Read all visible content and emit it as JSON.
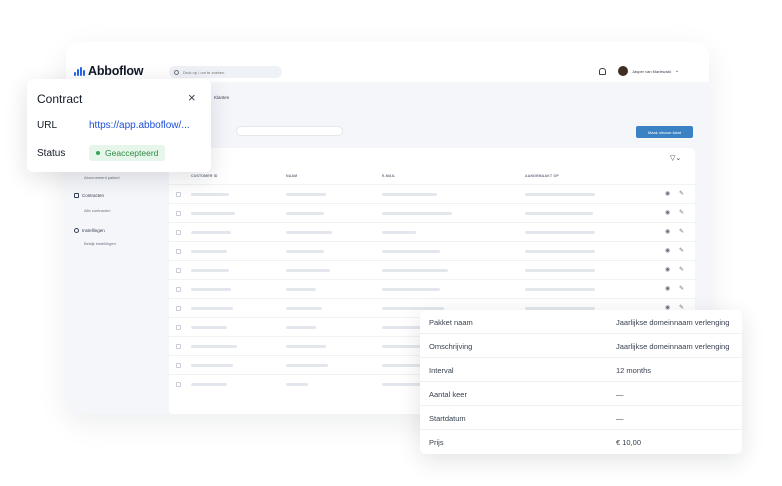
{
  "app": {
    "logo_text": "Abboflow",
    "search_placeholder": "Druk op / om te zoeken",
    "user_name": "Jasper van Marlewald",
    "page_title": "Klanten",
    "new_client_label": "Maak nieuwe klant",
    "accent_color": "#3b82c4"
  },
  "sidebar": {
    "subscription_package_item": "Abonnement pakket",
    "contracts_label": "Contracten",
    "all_contracts_item": "Alle contracten",
    "settings_label": "Instellingen",
    "view_settings_item": "Bekijk instellingen"
  },
  "table": {
    "columns": [
      "CUSTOMER ID",
      "NAAM",
      "E-MAIL",
      "AANGEMAAKT OP"
    ],
    "row_count": 11
  },
  "contract_popup": {
    "title": "Contract",
    "url_label": "URL",
    "url_value": "https://app.abboflow/...",
    "status_label": "Status",
    "status_value": "Geaccepteerd",
    "status_color": "#2f8a46"
  },
  "details": {
    "rows": [
      {
        "label": "Pakket naam",
        "value": "Jaarlijkse domeinnaam verlenging"
      },
      {
        "label": "Omschrijving",
        "value": "Jaarlijkse domeinnaam verlenging"
      },
      {
        "label": "Interval",
        "value": "12 months"
      },
      {
        "label": "Aantal keer",
        "value": "—"
      },
      {
        "label": "Startdatum",
        "value": "—"
      },
      {
        "label": "Prijs",
        "value": "€ 10,00"
      }
    ]
  }
}
